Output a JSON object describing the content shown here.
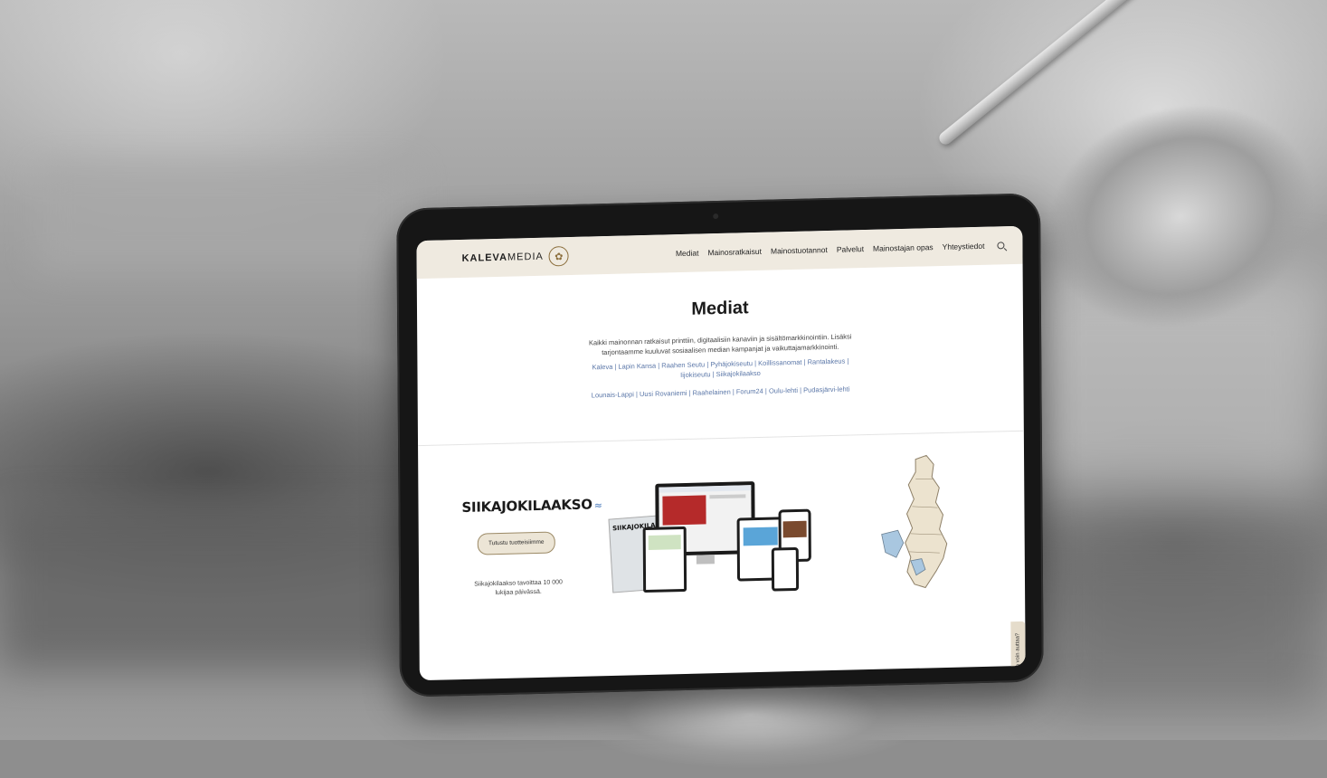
{
  "site": {
    "logo_text_bold": "KALEVA",
    "logo_text_light": "MEDIA",
    "nav": [
      "Mediat",
      "Mainosratkaisut",
      "Mainostuotannot",
      "Palvelut",
      "Mainostajan opas",
      "Yhteystiedot"
    ]
  },
  "hero": {
    "title": "Mediat",
    "intro": "Kaikki mainonnan ratkaisut printtiin, digitaalisiin kanaviin ja sisältömarkkinointiin. Lisäksi tarjontaamme kuuluvat sosiaalisen median kampanjat ja vaikuttajamarkkinointi.",
    "links_line1": "Kaleva | Lapin Kansa | Raahen Seutu | Pyhäjokiseutu | Koillissanomat | Rantalakeus | Iijokiseutu | Siikajokilaakso",
    "links_line2": "Lounais-Lappi | Uusi Rovaniemi | Raahelainen | Forum24 | Oulu-lehti | Pudasjärvi-lehti"
  },
  "brand": {
    "name": "SIIKAJOKILAAKSO",
    "cta": "Tutustu tuotteisiimme",
    "reach": "Siikajokilaakso tavoittaa 10 000 lukijaa päivässä.",
    "paper_headline": "SIIKAJOKILAAKSO"
  },
  "chat": {
    "label": "CHAT: Kuinka voin auttaa?"
  },
  "colors": {
    "header_bg": "#efeae0",
    "link": "#5b77a8",
    "button_border": "#9b8965"
  }
}
